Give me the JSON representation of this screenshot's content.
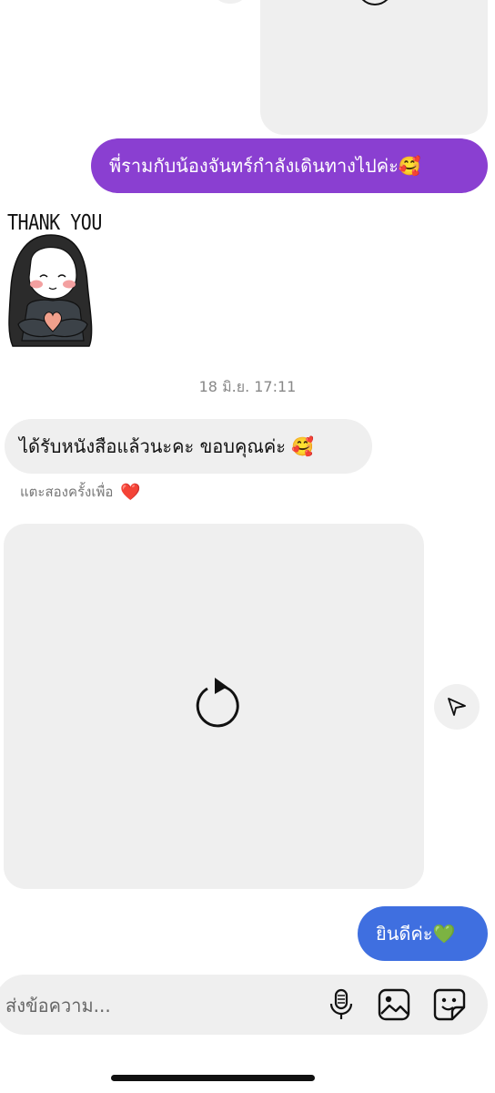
{
  "conversation": {
    "sent_message_1": "พี่รามกับน้องจันทร์กำลังเดินทางไปค่ะ🥰",
    "sticker_text": "THANK YOU",
    "timestamp": "18 มิ.ย. 17:11",
    "received_message": "ได้รับหนังสือแล้วนะคะ ขอบคุณค่ะ 🥰",
    "double_tap_hint": "แตะสองครั้งเพื่อ",
    "hint_emoji": "❤️",
    "sent_message_2": "ยินดีค่ะ💚"
  },
  "composer": {
    "placeholder": "ส่งข้อความ..."
  },
  "icons": {
    "reload": "reload-icon",
    "share": "send-icon",
    "mic": "microphone-icon",
    "gallery": "gallery-icon",
    "sticker": "sticker-icon"
  },
  "colors": {
    "purple_bubble": "#8a3fd1",
    "blue_bubble": "#3f6fe0",
    "received_bubble": "#efefef"
  }
}
